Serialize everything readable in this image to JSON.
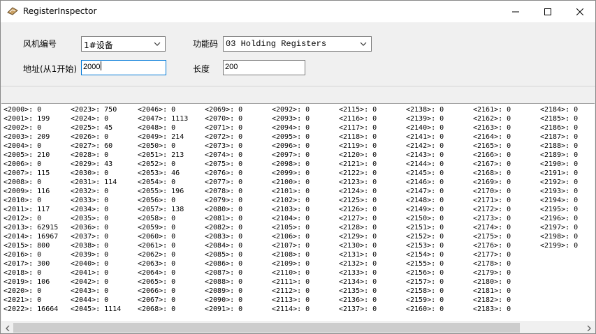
{
  "window": {
    "title": "RegisterInspector",
    "icons": {
      "app": "app-icon",
      "minimize": "minimize-icon",
      "maximize": "maximize-icon",
      "close": "close-icon"
    }
  },
  "form": {
    "fan_label": "风机编号",
    "fan_value": "1#设备",
    "func_label": "功能码",
    "func_value": "03 Holding Registers",
    "addr_label": "地址(从1开始)",
    "addr_value": "2000",
    "len_label": "长度",
    "len_value": "200"
  },
  "registers": {
    "columns": [
      [
        "<2000>: 0",
        "<2001>: 199",
        "<2002>: 0",
        "<2003>: 209",
        "<2004>: 0",
        "<2005>: 210",
        "<2006>: 0",
        "<2007>: 115",
        "<2008>: 0",
        "<2009>: 116",
        "<2010>: 0",
        "<2011>: 117",
        "<2012>: 0",
        "<2013>: 62915",
        "<2014>: 16967",
        "<2015>: 800",
        "<2016>: 0",
        "<2017>: 300",
        "<2018>: 0",
        "<2019>: 106",
        "<2020>: 0",
        "<2021>: 0",
        "<2022>: 16664"
      ],
      [
        "<2023>: 750",
        "<2024>: 0",
        "<2025>: 45",
        "<2026>: 0",
        "<2027>: 60",
        "<2028>: 0",
        "<2029>: 43",
        "<2030>: 0",
        "<2031>: 114",
        "<2032>: 0",
        "<2033>: 0",
        "<2034>: 0",
        "<2035>: 0",
        "<2036>: 0",
        "<2037>: 0",
        "<2038>: 0",
        "<2039>: 0",
        "<2040>: 0",
        "<2041>: 0",
        "<2042>: 0",
        "<2043>: 0",
        "<2044>: 0",
        "<2045>: 1114"
      ],
      [
        "<2046>: 0",
        "<2047>: 1113",
        "<2048>: 0",
        "<2049>: 214",
        "<2050>: 0",
        "<2051>: 213",
        "<2052>: 0",
        "<2053>: 46",
        "<2054>: 0",
        "<2055>: 196",
        "<2056>: 0",
        "<2057>: 138",
        "<2058>: 0",
        "<2059>: 0",
        "<2060>: 0",
        "<2061>: 0",
        "<2062>: 0",
        "<2063>: 0",
        "<2064>: 0",
        "<2065>: 0",
        "<2066>: 0",
        "<2067>: 0",
        "<2068>: 0"
      ],
      [
        "<2069>: 0",
        "<2070>: 0",
        "<2071>: 0",
        "<2072>: 0",
        "<2073>: 0",
        "<2074>: 0",
        "<2075>: 0",
        "<2076>: 0",
        "<2077>: 0",
        "<2078>: 0",
        "<2079>: 0",
        "<2080>: 0",
        "<2081>: 0",
        "<2082>: 0",
        "<2083>: 0",
        "<2084>: 0",
        "<2085>: 0",
        "<2086>: 0",
        "<2087>: 0",
        "<2088>: 0",
        "<2089>: 0",
        "<2090>: 0",
        "<2091>: 0"
      ],
      [
        "<2092>: 0",
        "<2093>: 0",
        "<2094>: 0",
        "<2095>: 0",
        "<2096>: 0",
        "<2097>: 0",
        "<2098>: 0",
        "<2099>: 0",
        "<2100>: 0",
        "<2101>: 0",
        "<2102>: 0",
        "<2103>: 0",
        "<2104>: 0",
        "<2105>: 0",
        "<2106>: 0",
        "<2107>: 0",
        "<2108>: 0",
        "<2109>: 0",
        "<2110>: 0",
        "<2111>: 0",
        "<2112>: 0",
        "<2113>: 0",
        "<2114>: 0"
      ],
      [
        "<2115>: 0",
        "<2116>: 0",
        "<2117>: 0",
        "<2118>: 0",
        "<2119>: 0",
        "<2120>: 0",
        "<2121>: 0",
        "<2122>: 0",
        "<2123>: 0",
        "<2124>: 0",
        "<2125>: 0",
        "<2126>: 0",
        "<2127>: 0",
        "<2128>: 0",
        "<2129>: 0",
        "<2130>: 0",
        "<2131>: 0",
        "<2132>: 0",
        "<2133>: 0",
        "<2134>: 0",
        "<2135>: 0",
        "<2136>: 0",
        "<2137>: 0"
      ],
      [
        "<2138>: 0",
        "<2139>: 0",
        "<2140>: 0",
        "<2141>: 0",
        "<2142>: 0",
        "<2143>: 0",
        "<2144>: 0",
        "<2145>: 0",
        "<2146>: 0",
        "<2147>: 0",
        "<2148>: 0",
        "<2149>: 0",
        "<2150>: 0",
        "<2151>: 0",
        "<2152>: 0",
        "<2153>: 0",
        "<2154>: 0",
        "<2155>: 0",
        "<2156>: 0",
        "<2157>: 0",
        "<2158>: 0",
        "<2159>: 0",
        "<2160>: 0"
      ],
      [
        "<2161>: 0",
        "<2162>: 0",
        "<2163>: 0",
        "<2164>: 0",
        "<2165>: 0",
        "<2166>: 0",
        "<2167>: 0",
        "<2168>: 0",
        "<2169>: 0",
        "<2170>: 0",
        "<2171>: 0",
        "<2172>: 0",
        "<2173>: 0",
        "<2174>: 0",
        "<2175>: 0",
        "<2176>: 0",
        "<2177>: 0",
        "<2178>: 0",
        "<2179>: 0",
        "<2180>: 0",
        "<2181>: 0",
        "<2182>: 0",
        "<2183>: 0"
      ],
      [
        "<2184>: 0",
        "<2185>: 0",
        "<2186>: 0",
        "<2187>: 0",
        "<2188>: 0",
        "<2189>: 0",
        "<2190>: 0",
        "<2191>: 0",
        "<2192>: 0",
        "<2193>: 0",
        "<2194>: 0",
        "<2195>: 0",
        "<2196>: 0",
        "<2197>: 0",
        "<2198>: 0",
        "<2199>: 0"
      ]
    ]
  },
  "scrollbar": {
    "left_icon": "scroll-left-arrow-icon",
    "right_icon": "scroll-right-arrow-icon"
  }
}
